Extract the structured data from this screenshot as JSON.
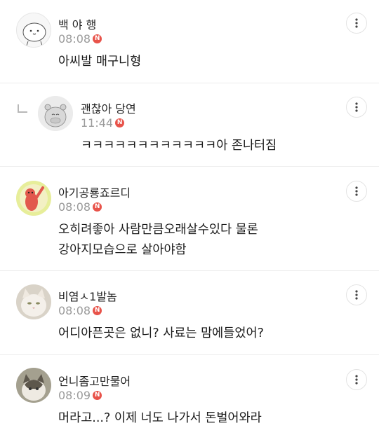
{
  "comments": [
    {
      "name": "백 야 행",
      "time": "08:08",
      "badge": "N",
      "text_lines": [
        "아씨발 매구니형"
      ],
      "avatar": "white-blob-avatar"
    },
    {
      "name": "괜찮아 당연",
      "time": "11:44",
      "badge": "N",
      "text_lines": [
        "ㅋㅋㅋㅋㅋㅋㅋㅋㅋㅋㅋㅋ아 존나터짐"
      ],
      "avatar": "hippo-avatar",
      "is_reply": true
    },
    {
      "name": "아기공룡죠르디",
      "time": "08:08",
      "badge": "N",
      "text_lines": [
        "오히려좋아 사람만큼오래살수있다 물론",
        "강아지모습으로 살아야함"
      ],
      "avatar": "red-character-avatar"
    },
    {
      "name": "비염ㅅ1발놈",
      "time": "08:08",
      "badge": "N",
      "text_lines": [
        "어디아픈곳은 없니? 사료는 맘에들었어?"
      ],
      "avatar": "white-cat-avatar"
    },
    {
      "name": "언니좀고만물어",
      "time": "08:09",
      "badge": "N",
      "text_lines": [
        "머라고...? 이제 너도 나가서 돈벌어와라"
      ],
      "avatar": "tabby-cat-avatar"
    }
  ]
}
